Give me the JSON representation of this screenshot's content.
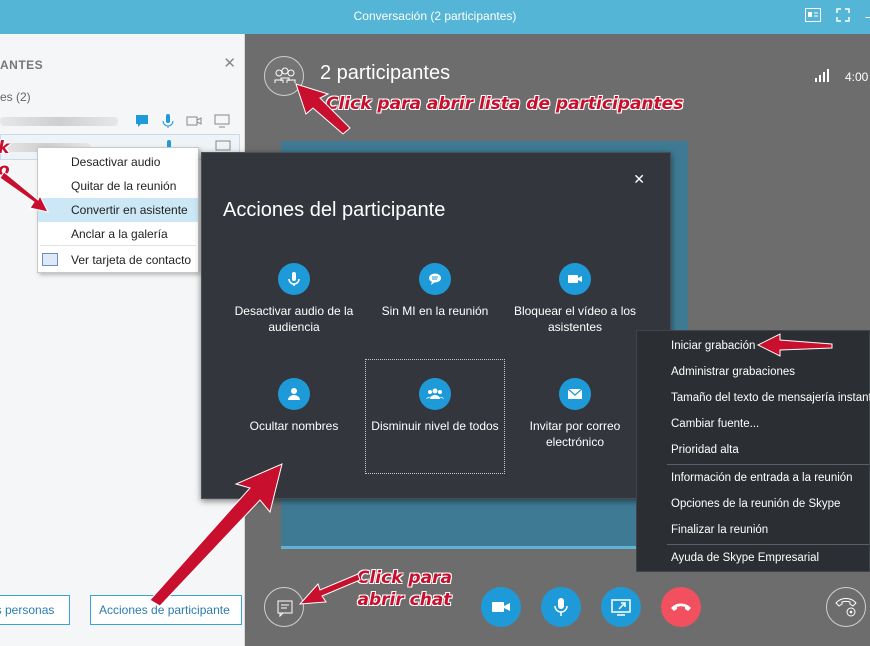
{
  "window": {
    "title": "Conversación (2 participantes)"
  },
  "left_panel": {
    "header": "ANTES",
    "group_label": "es (2)",
    "buttons": {
      "more_people": "ás personas",
      "participant_actions": "Acciones de participante"
    }
  },
  "context_menu": {
    "items": [
      "Desactivar audio",
      "Quitar de la reunión",
      "Convertir en asistente",
      "Anclar a la galería",
      "Ver tarjeta de contacto"
    ]
  },
  "stage": {
    "participants_label": "2 participantes",
    "timer": "4:00"
  },
  "dialog": {
    "title": "Acciones del participante",
    "actions": [
      {
        "label": "Desactivar audio de la audiencia",
        "icon": "mic-icon"
      },
      {
        "label": "Sin MI en la reunión",
        "icon": "chat-icon"
      },
      {
        "label": "Bloquear el vídeo a los asistentes",
        "icon": "camera-icon"
      },
      {
        "label": "Ocultar nombres",
        "icon": "person-icon"
      },
      {
        "label": "Disminuir nivel de todos",
        "icon": "group-icon"
      },
      {
        "label": "Invitar por correo electrónico",
        "icon": "mail-icon"
      }
    ]
  },
  "more_menu": {
    "items": [
      "Iniciar grabación",
      "Administrar grabaciones",
      "Tamaño del texto de mensajería instantánea",
      "Cambiar fuente...",
      "Prioridad alta",
      "Información de entrada a la reunión",
      "Opciones de la reunión de Skype",
      "Finalizar la reunión",
      "Ayuda de Skype Empresarial"
    ]
  },
  "annotations": {
    "participants_list": "Click para abrir lista de participantes",
    "chat_line1": "Click para",
    "chat_line2": "abrir chat",
    "left_line1": "k",
    "left_line2": "o"
  },
  "colors": {
    "accent": "#1f9ad8",
    "titlebar": "#54b5d6",
    "hangup": "#f2505f",
    "annotation": "#c8102e"
  }
}
